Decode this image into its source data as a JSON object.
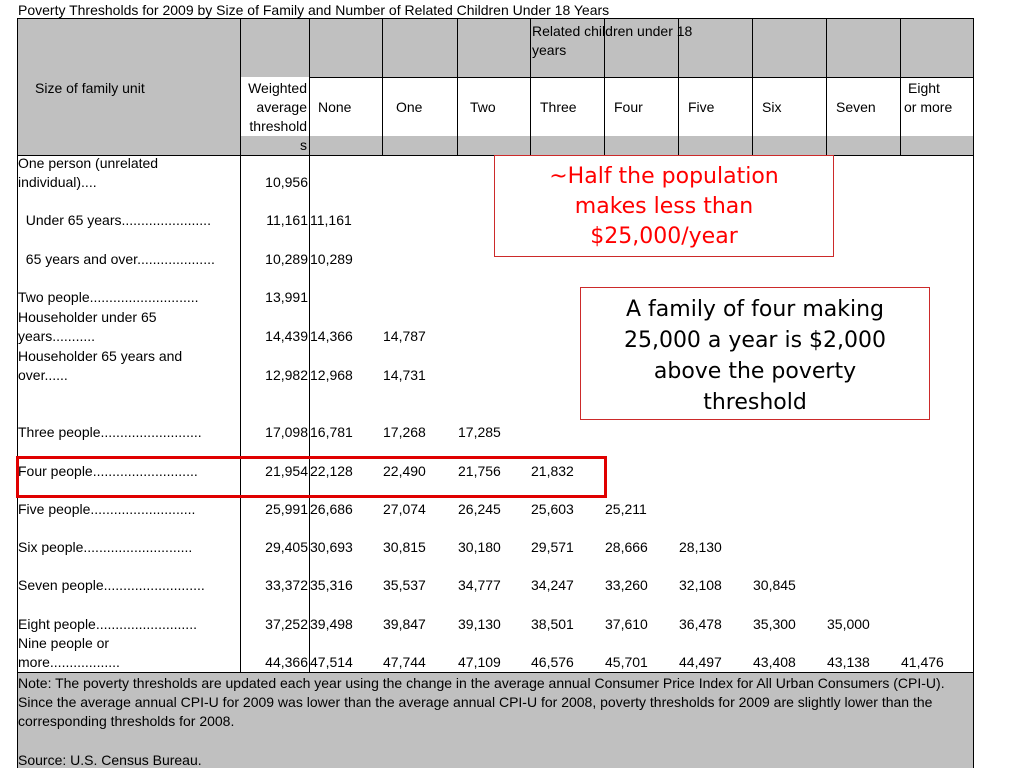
{
  "title": "Poverty Thresholds for 2009 by Size of Family and Number of Related Children Under 18 Years",
  "header": {
    "size_label": "Size of family unit",
    "weighted_label_1": "Weighted",
    "weighted_label_2": "average",
    "weighted_label_3": "threshold",
    "weighted_label_4": "s",
    "related_label_1": "Related children under 18",
    "related_label_2": "years",
    "cols": [
      "None",
      "One",
      "Two",
      "Three",
      "Four",
      "Five",
      "Six",
      "Seven"
    ],
    "eight_1": "Eight",
    "eight_2": "or more"
  },
  "rows": [
    {
      "label": [
        "One person (unrelated",
        "individual)...."
      ],
      "avg": "10,956",
      "vals": []
    },
    {
      "label": [
        "  Under 65 years......................."
      ],
      "avg": "11,161",
      "vals": [
        "11,161"
      ]
    },
    {
      "label": [
        "  65 years and over...................."
      ],
      "avg": "10,289",
      "vals": [
        "10,289"
      ]
    },
    {
      "label": [
        "Two people............................"
      ],
      "avg": "13,991",
      "vals": []
    },
    {
      "label": [
        "  Householder under 65",
        "years..........."
      ],
      "avg": "14,439",
      "vals": [
        "14,366",
        "14,787"
      ]
    },
    {
      "label": [
        "  Householder 65 years and",
        "over......"
      ],
      "avg": "12,982",
      "vals": [
        "12,968",
        "14,731"
      ]
    },
    {
      "label": [
        "Three people.........................."
      ],
      "avg": "17,098",
      "vals": [
        "16,781",
        "17,268",
        "17,285"
      ]
    },
    {
      "label": [
        "Four people..........................."
      ],
      "avg": "21,954",
      "vals": [
        "22,128",
        "22,490",
        "21,756",
        "21,832"
      ]
    },
    {
      "label": [
        "Five people..........................."
      ],
      "avg": "25,991",
      "vals": [
        "26,686",
        "27,074",
        "26,245",
        "25,603",
        "25,211"
      ]
    },
    {
      "label": [
        "Six people............................"
      ],
      "avg": "29,405",
      "vals": [
        "30,693",
        "30,815",
        "30,180",
        "29,571",
        "28,666",
        "28,130"
      ]
    },
    {
      "label": [
        "Seven people.........................."
      ],
      "avg": "33,372",
      "vals": [
        "35,316",
        "35,537",
        "34,777",
        "34,247",
        "33,260",
        "32,108",
        "30,845"
      ]
    },
    {
      "label": [
        "Eight people.........................."
      ],
      "avg": "37,252",
      "vals": [
        "39,498",
        "39,847",
        "39,130",
        "38,501",
        "37,610",
        "36,478",
        "35,300",
        "35,000"
      ]
    },
    {
      "label": [
        "Nine people or",
        "more.................."
      ],
      "avg": "44,366",
      "vals": [
        "47,514",
        "47,744",
        "47,109",
        "46,576",
        "45,701",
        "44,497",
        "43,408",
        "43,138",
        "41,476"
      ]
    }
  ],
  "note": "Note:  The poverty thresholds are updated each year using the change in the average annual Consumer Price Index for All Urban Consumers (CPI-U).  Since the average annual CPI-U for 2009 was lower than the average annual CPI-U for 2008, poverty thresholds for 2009 are slightly lower than the corresponding thresholds for 2008.",
  "source": "Source:  U.S. Census Bureau.",
  "callout_1": [
    "~Half the population",
    "makes less than",
    "$25,000/year"
  ],
  "callout_2": [
    "A family of four making",
    "25,000 a year is $2,000",
    "above the poverty",
    "threshold"
  ],
  "colors": {
    "header_grey": "#c0c0c0",
    "callout_red_text": "#ff0000",
    "highlight_red": "#e00000"
  }
}
